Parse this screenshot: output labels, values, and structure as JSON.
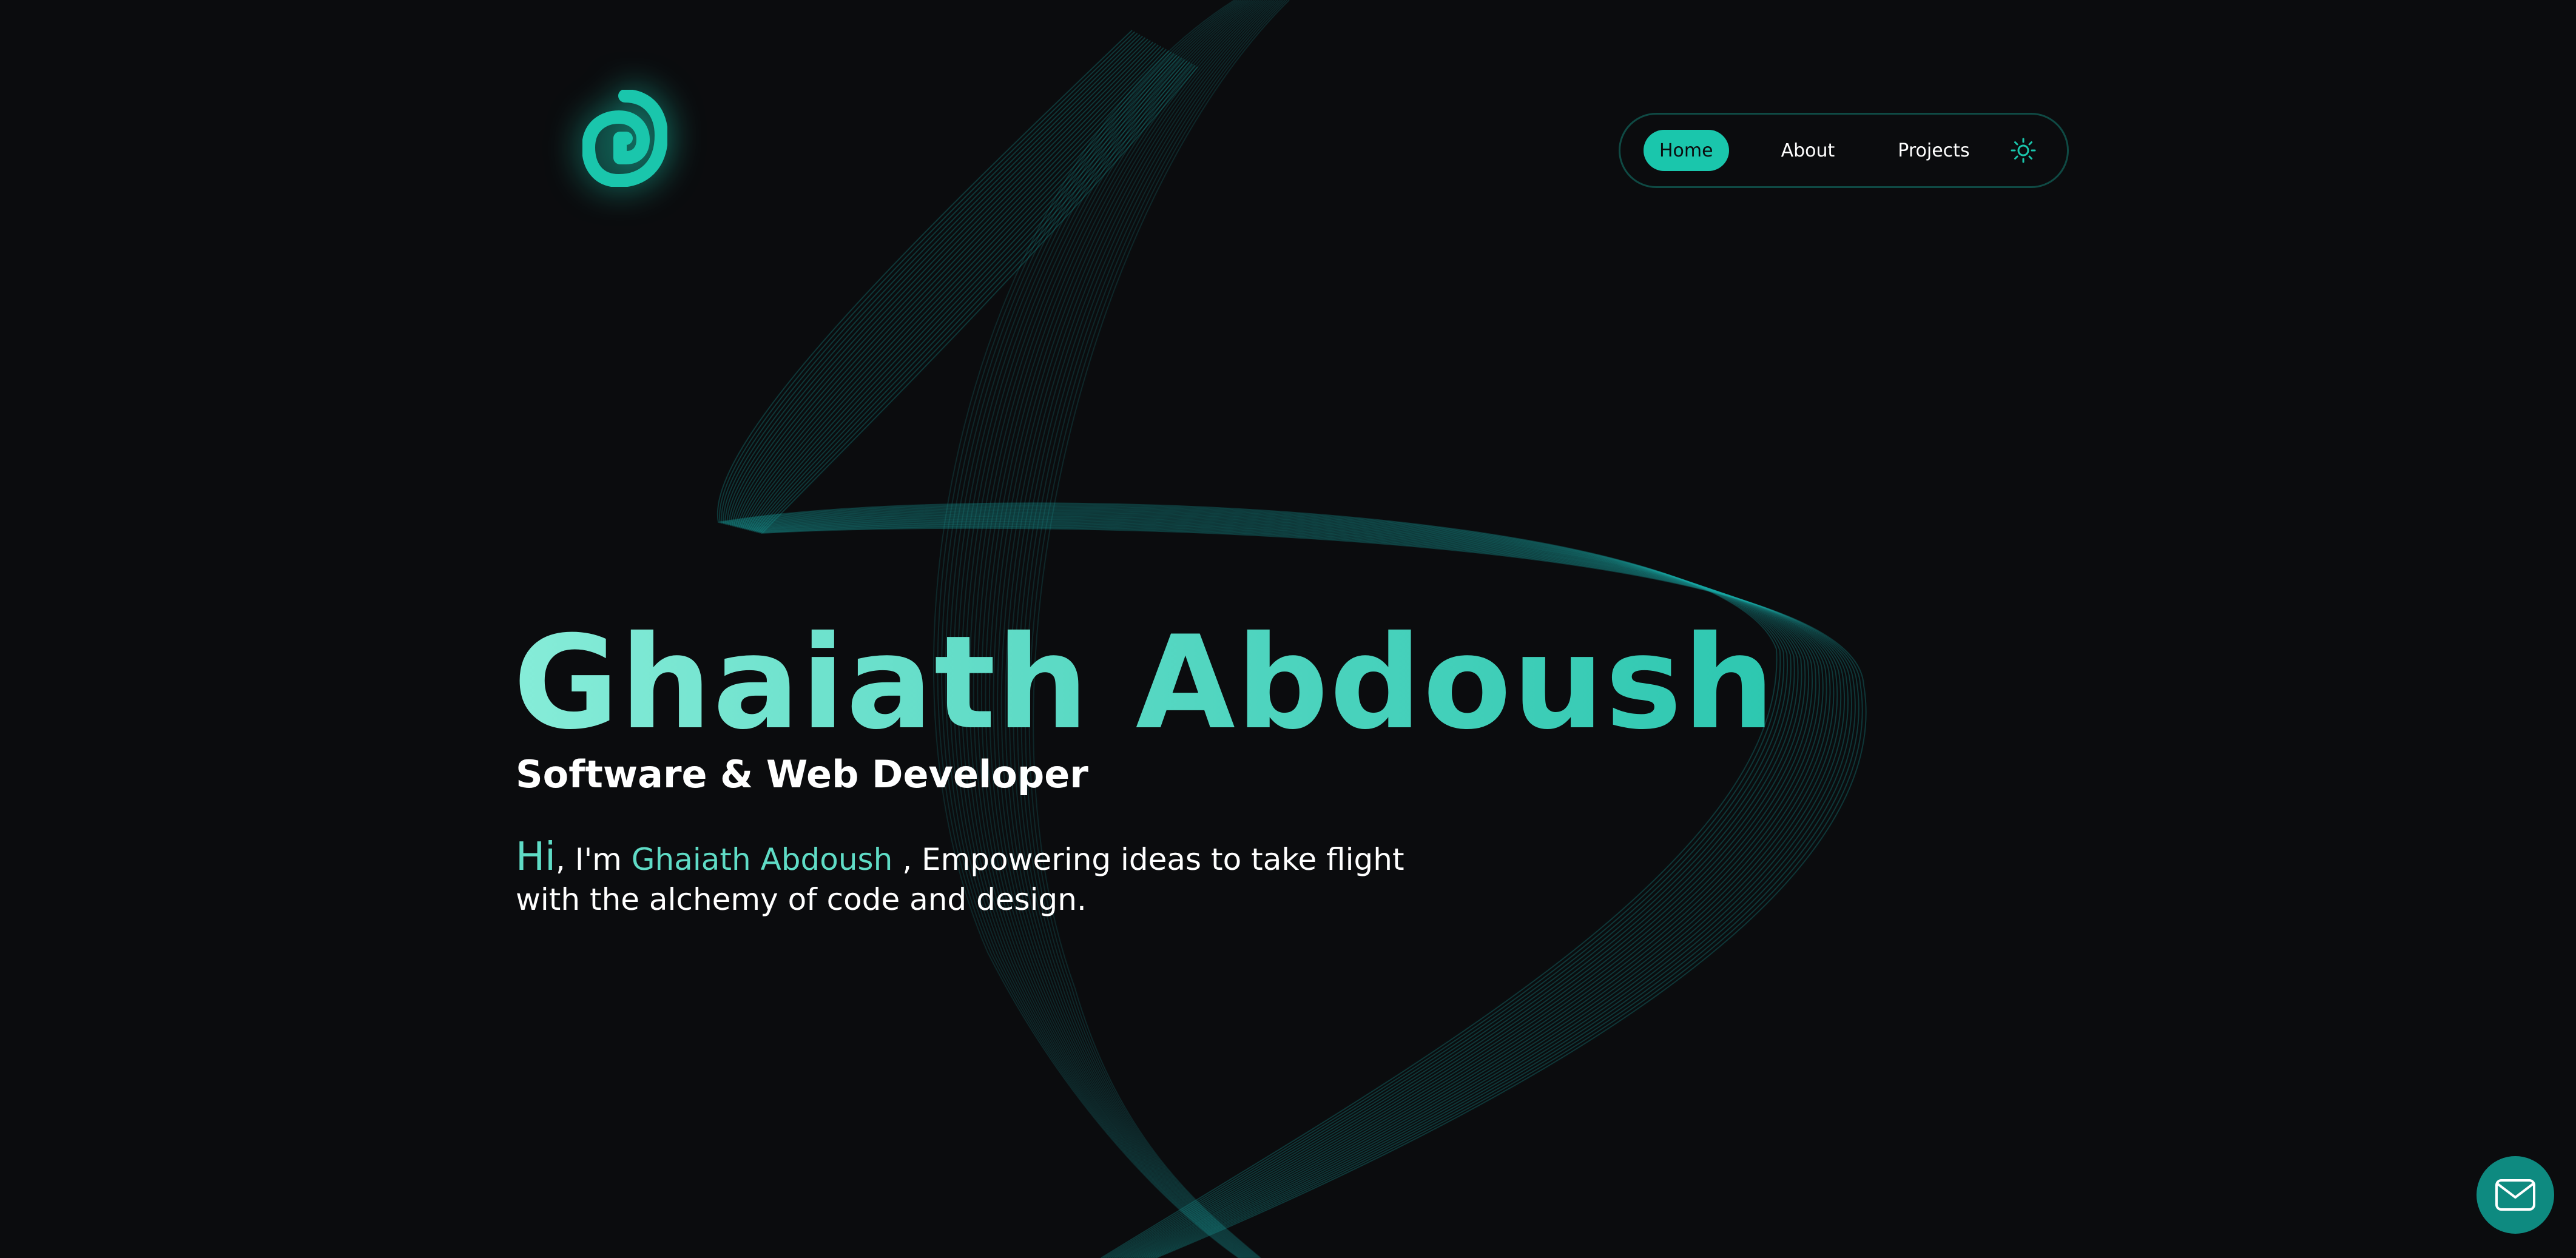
{
  "brand": {
    "logo_icon": "spiral-logo-icon",
    "accent_color": "#1ac6ac"
  },
  "nav": {
    "items": [
      {
        "label": "Home",
        "active": true
      },
      {
        "label": "About",
        "active": false
      },
      {
        "label": "Projects",
        "active": false
      }
    ],
    "theme_toggle_icon": "sun-icon"
  },
  "hero": {
    "name": "Ghaiath Abdoush",
    "role": "Software & Web Developer",
    "intro": {
      "greeting": "Hi",
      "after_greeting": ", I'm ",
      "name": "Ghaiath Abdoush",
      "rest": " , Empowering ideas to take flight with the alchemy of code and design."
    }
  },
  "contact": {
    "icon": "mail-icon"
  },
  "colors": {
    "background": "#0b0c0e",
    "accent": "#1ac6ac",
    "accent_light": "#5fdcc6",
    "text": "#ffffff",
    "mail_button": "#0e8a80"
  }
}
